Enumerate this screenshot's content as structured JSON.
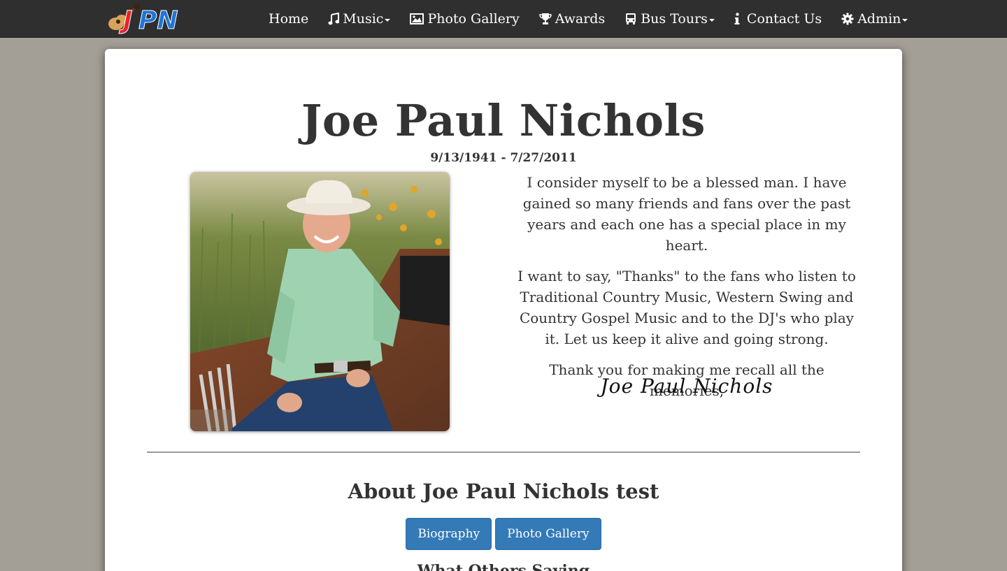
{
  "navbar": {
    "logo_text": "JPN",
    "items": [
      {
        "label": "Home",
        "icon": "none",
        "dropdown": false
      },
      {
        "label": "Music",
        "icon": "music-note-icon",
        "dropdown": true
      },
      {
        "label": "Photo Gallery",
        "icon": "picture-icon",
        "dropdown": false
      },
      {
        "label": "Awards",
        "icon": "trophy-icon",
        "dropdown": false
      },
      {
        "label": "Bus Tours",
        "icon": "bus-icon",
        "dropdown": true
      },
      {
        "label": "Contact Us",
        "icon": "info-icon",
        "dropdown": false
      },
      {
        "label": "Admin",
        "icon": "gear-icon",
        "dropdown": true
      }
    ]
  },
  "hero": {
    "name": "Joe Paul Nichols",
    "dates": "9/13/1941 - 7/27/2011",
    "message": [
      "I consider myself to be a blessed man. I have gained so many friends and fans over the past years and each one has a special place in my heart.",
      "I want to say, \"Thanks\" to the fans who listen to Traditional Country Music, Western Swing and Country Gospel Music and to the DJ's who play it. Let us keep it alive and going strong.",
      "Thank you for making me recall all the memories,"
    ],
    "signature": "Joe Paul Nichols"
  },
  "about": {
    "title": "About Joe Paul Nichols test",
    "buttons": [
      "Biography",
      "Photo Gallery"
    ],
    "others_heading": "What Others Saying"
  },
  "colors": {
    "page_bg": "#a39e96",
    "navbar_bg": "#2f2f2f",
    "button_bg": "#337ab7"
  }
}
